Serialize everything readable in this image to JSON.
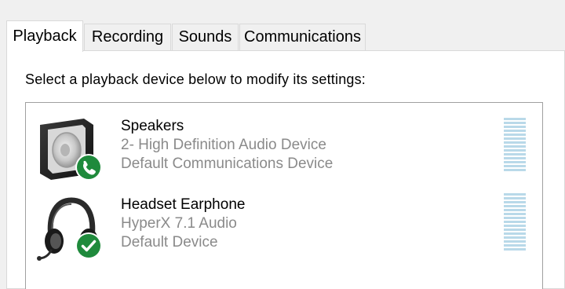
{
  "tabs": [
    {
      "label": "Playback",
      "active": true
    },
    {
      "label": "Recording",
      "active": false
    },
    {
      "label": "Sounds",
      "active": false
    },
    {
      "label": "Communications",
      "active": false
    }
  ],
  "instruction": "Select a playback device below to modify its settings:",
  "devices": [
    {
      "name": "Speakers",
      "line2": "2- High Definition Audio Device",
      "line3": "Default Communications Device",
      "icon": "speaker-icon",
      "badge": "phone-badge-icon"
    },
    {
      "name": "Headset Earphone",
      "line2": "HyperX 7.1 Audio",
      "line3": "Default Device",
      "icon": "headset-icon",
      "badge": "check-badge-icon"
    }
  ],
  "colors": {
    "badge_green": "#1f8a3c",
    "meter": "#b9d9e9",
    "secondary_text": "#8a8a8a"
  }
}
